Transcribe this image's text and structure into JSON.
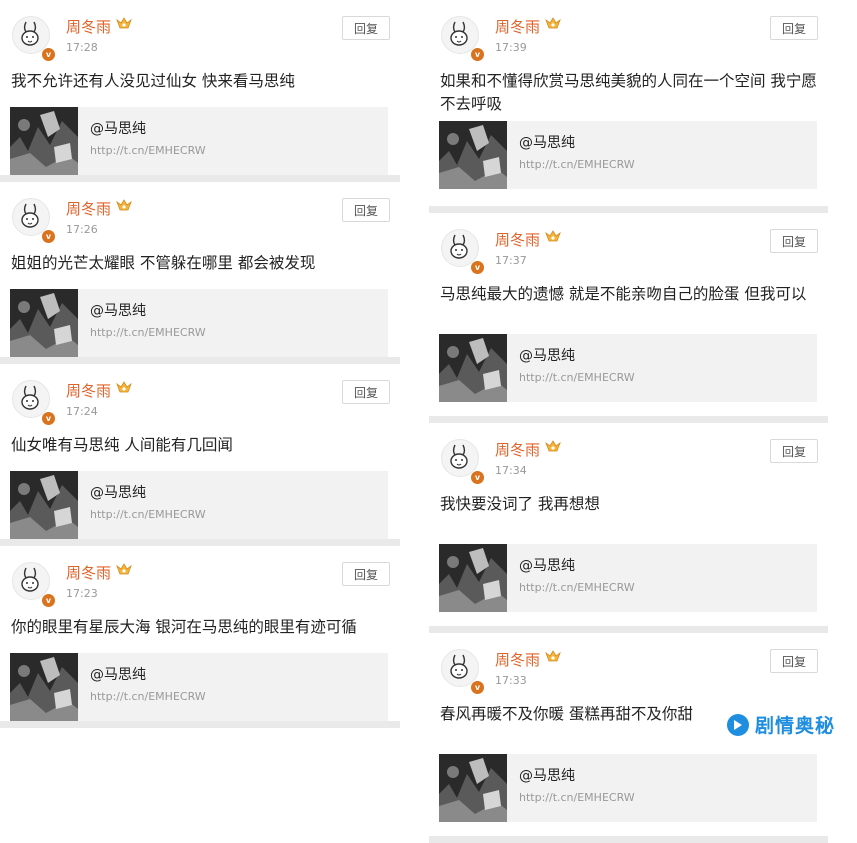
{
  "left": [
    {
      "username": "周冬雨",
      "time": "17:28",
      "reply": "回复",
      "content": "我不允许还有人没见过仙女 快来看马思纯",
      "card": {
        "title": "@马思纯",
        "link": "http://t.cn/EMHECRW"
      }
    },
    {
      "username": "周冬雨",
      "time": "17:26",
      "reply": "回复",
      "content": "姐姐的光芒太耀眼 不管躲在哪里 都会被发现",
      "card": {
        "title": "@马思纯",
        "link": "http://t.cn/EMHECRW"
      }
    },
    {
      "username": "周冬雨",
      "time": "17:24",
      "reply": "回复",
      "content": "仙女唯有马思纯 人间能有几回闻",
      "card": {
        "title": "@马思纯",
        "link": "http://t.cn/EMHECRW"
      }
    },
    {
      "username": "周冬雨",
      "time": "17:23",
      "reply": "回复",
      "content": "你的眼里有星辰大海 银河在马思纯的眼里有迹可循",
      "card": {
        "title": "@马思纯",
        "link": "http://t.cn/EMHECRW"
      }
    }
  ],
  "right": [
    {
      "username": "周冬雨",
      "time": "17:39",
      "reply": "回复",
      "content": "如果和不懂得欣赏马思纯美貌的人同在一个空间 我宁愿不去呼吸",
      "card": {
        "title": "@马思纯",
        "link": "http://t.cn/EMHECRW"
      }
    },
    {
      "username": "周冬雨",
      "time": "17:37",
      "reply": "回复",
      "content": "马思纯最大的遗憾 就是不能亲吻自己的脸蛋 但我可以",
      "card": {
        "title": "@马思纯",
        "link": "http://t.cn/EMHECRW"
      }
    },
    {
      "username": "周冬雨",
      "time": "17:34",
      "reply": "回复",
      "content": "我快要没词了 我再想想",
      "card": {
        "title": "@马思纯",
        "link": "http://t.cn/EMHECRW"
      }
    },
    {
      "username": "周冬雨",
      "time": "17:33",
      "reply": "回复",
      "content": "春风再暖不及你暖 蛋糕再甜不及你甜",
      "card": {
        "title": "@马思纯",
        "link": "http://t.cn/EMHECRW"
      }
    }
  ],
  "watermark": {
    "text": "剧情奥秘"
  },
  "colors": {
    "username": "#e0632a",
    "badge": "#d9731e",
    "watermark": "#1f8ee0"
  }
}
